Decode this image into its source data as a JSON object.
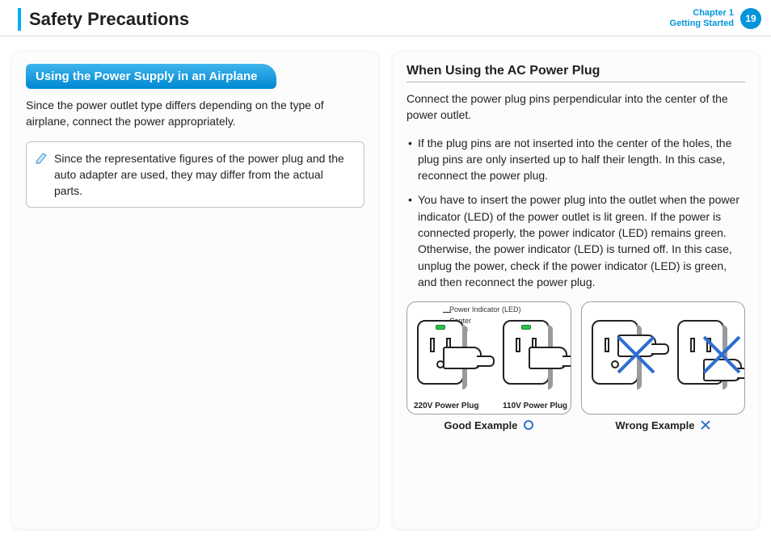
{
  "header": {
    "title": "Safety Precautions",
    "chapter_line1": "Chapter 1",
    "chapter_line2": "Getting Started",
    "page": "19"
  },
  "left": {
    "tab": "Using the Power Supply in an Airplane",
    "intro": "Since the power outlet type differs depending on the type of airplane, connect the power appropriately.",
    "note": "Since the representative figures of the power plug and the auto adapter are used, they may differ from the actual parts."
  },
  "right": {
    "subhead": "When Using the AC Power Plug",
    "intro": "Connect the power plug pins perpendicular into the center of the power outlet.",
    "bullets": [
      "If the plug pins are not inserted into the center of the holes, the plug pins are only inserted up to half their length. In this case, reconnect the power plug.",
      "You have to insert the power plug into the outlet when the power indicator (LED) of the power outlet is lit green. If the power is connected properly, the power indicator (LED) remains green.\nOtherwise, the power indicator (LED) is turned off. In this case, unplug the power, check if the power indicator (LED) is green, and then reconnect the power plug."
    ],
    "figure": {
      "power_indicator_label": "Power Indicator (LED)",
      "center_holes_label": "Center\nHoles",
      "plug_220": "220V Power Plug",
      "plug_110": "110V Power Plug",
      "good_caption": "Good Example",
      "wrong_caption": "Wrong Example"
    }
  }
}
